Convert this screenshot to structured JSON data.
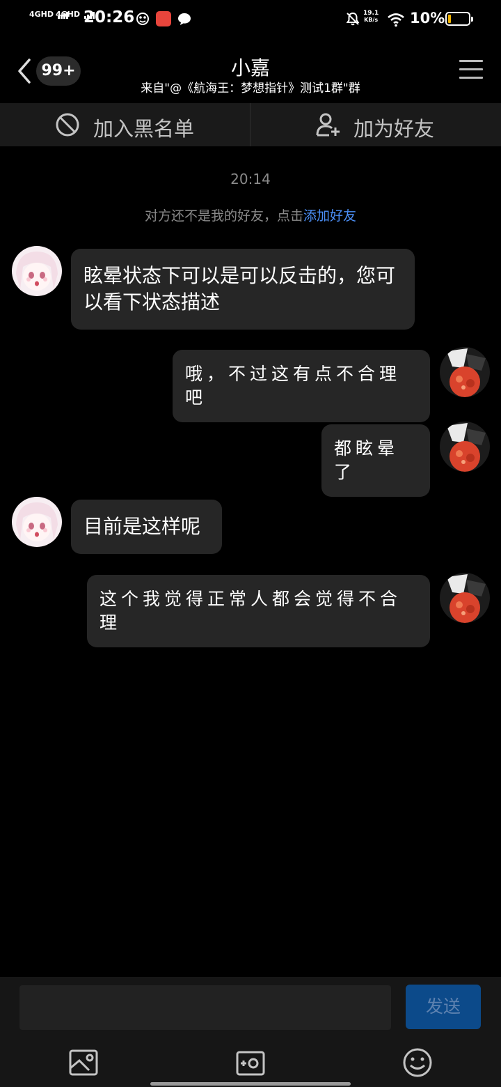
{
  "status_bar": {
    "network1": "4GHD",
    "network2": "4GHD",
    "time": "20:26",
    "net_speed_value": "19.1",
    "net_speed_unit": "KB/s",
    "battery_percent": "10%",
    "battery_level": 0.1
  },
  "header": {
    "unread_badge": "99+",
    "title": "小嘉",
    "subtitle": "来自\"@《航海王：梦想指针》测试1群\"群"
  },
  "actions": {
    "blacklist_label": "加入黑名单",
    "add_friend_label": "加为好友"
  },
  "chat": {
    "timestamp": "20:14",
    "notice_text": "对方还不是我的好友，点击",
    "notice_link": "添加好友",
    "messages": [
      {
        "side": "left",
        "text": "眩晕状态下可以是可以反击的，您可以看下状态描述"
      },
      {
        "side": "right",
        "text": "哦，不过这有点不合理吧"
      },
      {
        "side": "right",
        "text": "都眩晕了"
      },
      {
        "side": "left",
        "text": "目前是这样呢"
      },
      {
        "side": "right",
        "text": "这个我觉得正常人都会觉得不合理"
      }
    ]
  },
  "input_bar": {
    "input_value": "",
    "send_label": "发送",
    "tools": [
      "image-icon",
      "camera-icon",
      "emoji-icon"
    ]
  },
  "colors": {
    "background": "#000000",
    "bubble": "#262626",
    "link": "#4b8ef5",
    "send_button": "#0c4a8a",
    "battery_low": "#f2b400"
  }
}
